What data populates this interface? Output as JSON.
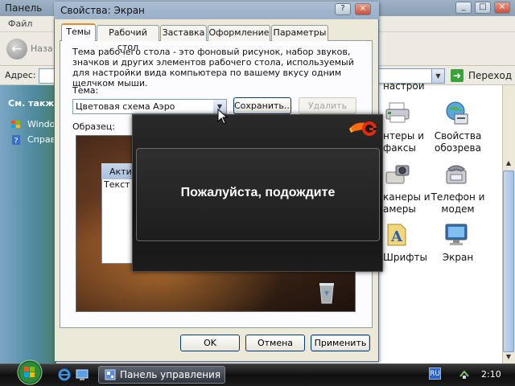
{
  "background_window": {
    "title": "Панель",
    "menu_file": "Файл",
    "back_label": "Наза",
    "address_label": "Адрес:",
    "go_label": "Переход",
    "see_also": "См. также",
    "tasks": [
      "Window",
      "Справ"
    ],
    "items": [
      {
        "label": "нтеры и\nфаксы",
        "icon": "printer-icon"
      },
      {
        "label": "Свойства\nобозрева",
        "icon": "internet-options-icon"
      },
      {
        "label": "канеры и\nамеры",
        "icon": "scanner-camera-icon"
      },
      {
        "label": "Телефон и\nмодем",
        "icon": "phone-modem-icon"
      },
      {
        "label": "Шрифты",
        "icon": "fonts-icon"
      },
      {
        "label": "Экран",
        "icon": "display-icon"
      }
    ],
    "header_fragment": "настрои"
  },
  "dialog": {
    "title": "Свойства: Экран",
    "tabs": [
      "Темы",
      "Рабочий стол",
      "Заставка",
      "Оформление",
      "Параметры"
    ],
    "active_tab": "Темы",
    "description": "Тема рабочего стола - это фоновый рисунок, набор звуков, значков и других элементов рабочего стола, используемый для настройки вида компьютера по вашему вкусу одним щелчком мыши.",
    "theme_label": "Тема:",
    "theme_value": "Цветовая схема Аэро",
    "save_button": "Сохранить...",
    "delete_button": "Удалить",
    "sample_label": "Образец:",
    "preview_window_title": "Актив",
    "preview_window_text": "Текст в",
    "ok_button": "OK",
    "cancel_button": "Отмена",
    "apply_button": "Применить"
  },
  "wait_overlay": {
    "message": "Пожалуйста, подождите"
  },
  "taskbar": {
    "task_button": "Панель управления",
    "language": "RU",
    "clock": "2:10"
  },
  "colors": {
    "dialog_face": "#ece9d8",
    "tab_highlight": "#e68b2c",
    "button_border": "#003c74",
    "overlay_bg": "#121212",
    "taskbar": "#101010"
  }
}
